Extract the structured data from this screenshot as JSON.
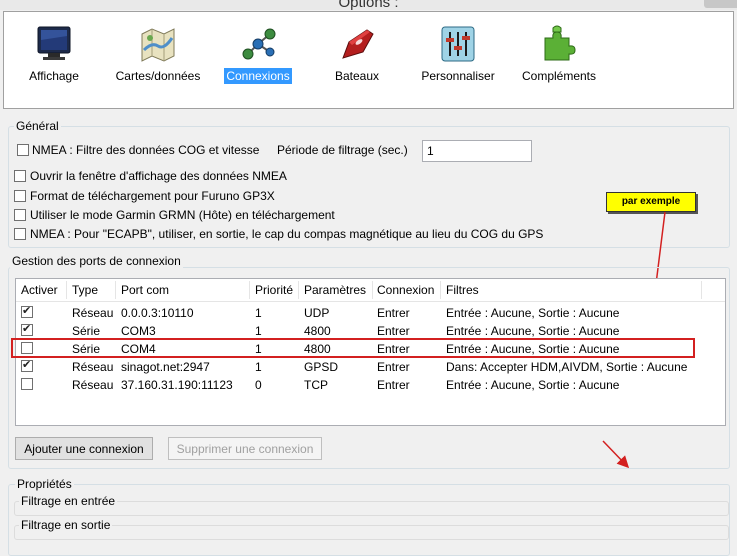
{
  "window": {
    "title": "Options :"
  },
  "toolbar": [
    {
      "label": "Affichage",
      "icon": "monitor-icon"
    },
    {
      "label": "Cartes/données",
      "icon": "chart-map-icon"
    },
    {
      "label": "Connexions",
      "icon": "connections-icon",
      "active": true
    },
    {
      "label": "Bateaux",
      "icon": "boat-icon"
    },
    {
      "label": "Personnaliser",
      "icon": "sliders-icon"
    },
    {
      "label": "Compléments",
      "icon": "puzzle-icon"
    }
  ],
  "general": {
    "title": "Général",
    "nmea_filter": "NMEA : Filtre des données COG et vitesse",
    "filter_period_label": "Période de filtrage (sec.)",
    "filter_period_value": "1",
    "options": [
      "Ouvrir la fenêtre d'affichage des données NMEA",
      "Format de téléchargement pour Furuno GP3X",
      "Utiliser le mode Garmin GRMN (Hôte) en téléchargement",
      "NMEA : Pour \"ECAPB\", utiliser, en sortie, le cap du compas magnétique  au lieu du COG du GPS"
    ]
  },
  "annotation": {
    "callout": "par exemple"
  },
  "ports": {
    "title": "Gestion des ports de connexion",
    "columns": [
      "Activer",
      "Type",
      "Port com",
      "Priorité",
      "Paramètres",
      "Connexion",
      "Filtres"
    ],
    "rows": [
      {
        "enabled": true,
        "type": "Réseau",
        "port": "0.0.0.3:10110",
        "priority": "1",
        "params": "UDP",
        "connection": "Entrer",
        "filters": "Entrée : Aucune, Sortie : Aucune"
      },
      {
        "enabled": true,
        "type": "Série",
        "port": "COM3",
        "priority": "1",
        "params": "4800",
        "connection": "Entrer",
        "filters": "Entrée : Aucune, Sortie : Aucune"
      },
      {
        "enabled": false,
        "type": "Série",
        "port": "COM4",
        "priority": "1",
        "params": "4800",
        "connection": "Entrer",
        "filters": "Entrée : Aucune, Sortie : Aucune"
      },
      {
        "enabled": true,
        "type": "Réseau",
        "port": "sinagot.net:2947",
        "priority": "1",
        "params": "GPSD",
        "connection": "Entrer",
        "filters": "Dans: Accepter HDM,AIVDM, Sortie : Aucune"
      },
      {
        "enabled": false,
        "type": "Réseau",
        "port": "37.160.31.190:11123",
        "priority": "0",
        "params": "TCP",
        "connection": "Entrer",
        "filters": "Entrée : Aucune, Sortie : Aucune"
      }
    ],
    "add_button": "Ajouter une connexion",
    "remove_button": "Supprimer une connexion"
  },
  "properties": {
    "title": "Propriétés",
    "input_filter": "Filtrage en entrée",
    "output_filter": "Filtrage en sortie"
  },
  "colors": {
    "accent": "#3399ff",
    "highlight_box": "#d32020",
    "callout_bg": "#ffff00"
  }
}
